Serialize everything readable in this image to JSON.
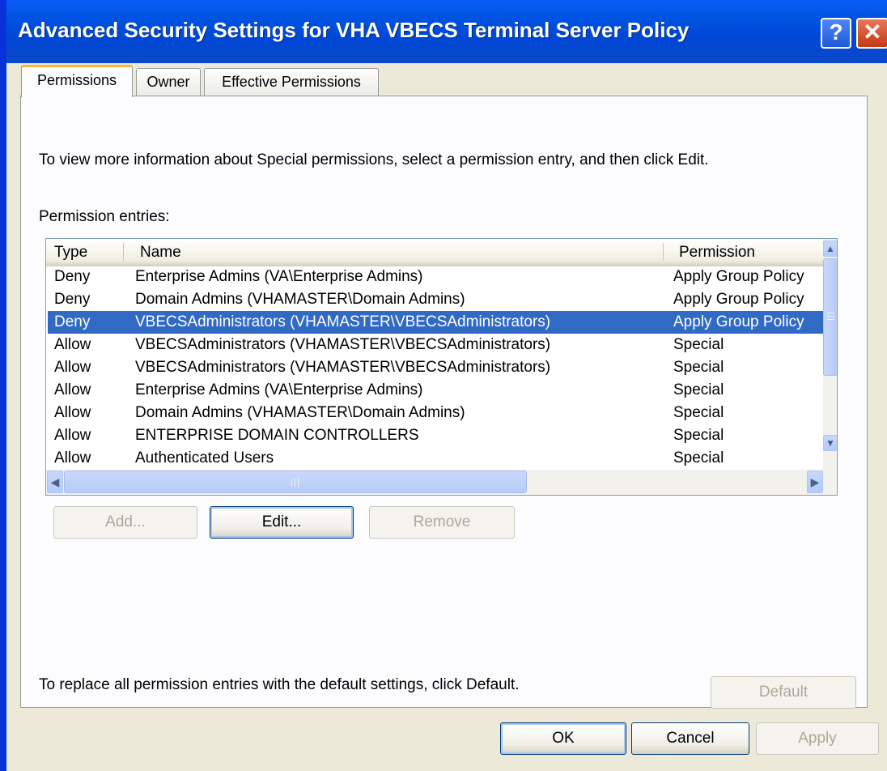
{
  "window": {
    "title": "Advanced Security Settings for VHA VBECS Terminal Server Policy",
    "help_glyph": "?",
    "close_glyph": "✕"
  },
  "tabs": [
    {
      "label": "Permissions",
      "active": true
    },
    {
      "label": "Owner",
      "active": false
    },
    {
      "label": "Effective Permissions",
      "active": false
    }
  ],
  "permissions": {
    "info_text": "To view more information about Special permissions, select a permission entry, and then click Edit.",
    "entries_label": "Permission entries:",
    "columns": [
      "Type",
      "Name",
      "Permission"
    ],
    "rows": [
      {
        "type": "Deny",
        "name": "Enterprise Admins (VA\\Enterprise Admins)",
        "permission": "Apply Group Policy"
      },
      {
        "type": "Deny",
        "name": "Domain Admins (VHAMASTER\\Domain Admins)",
        "permission": "Apply Group Policy"
      },
      {
        "type": "Deny",
        "name": "VBECSAdministrators (VHAMASTER\\VBECSAdministrators)",
        "permission": "Apply Group Policy"
      },
      {
        "type": "Allow",
        "name": "VBECSAdministrators (VHAMASTER\\VBECSAdministrators)",
        "permission": "Special"
      },
      {
        "type": "Allow",
        "name": "VBECSAdministrators (VHAMASTER\\VBECSAdministrators)",
        "permission": "Special"
      },
      {
        "type": "Allow",
        "name": "Enterprise Admins (VA\\Enterprise Admins)",
        "permission": "Special"
      },
      {
        "type": "Allow",
        "name": "Domain Admins (VHAMASTER\\Domain Admins)",
        "permission": "Special"
      },
      {
        "type": "Allow",
        "name": "ENTERPRISE DOMAIN CONTROLLERS",
        "permission": "Special"
      },
      {
        "type": "Allow",
        "name": "Authenticated Users",
        "permission": "Special"
      }
    ],
    "selected_row_index": 2,
    "add_label": "Add...",
    "edit_label": "Edit...",
    "remove_label": "Remove",
    "replace_text": "To replace all permission entries with the default settings, click Default.",
    "default_label": "Default"
  },
  "footer": {
    "ok_label": "OK",
    "cancel_label": "Cancel",
    "apply_label": "Apply"
  },
  "colors": {
    "titlebar": "#0054e3",
    "selection": "#316ac5",
    "dialog_bg": "#ece9d8",
    "active_tab_accent": "#f7b53c"
  }
}
